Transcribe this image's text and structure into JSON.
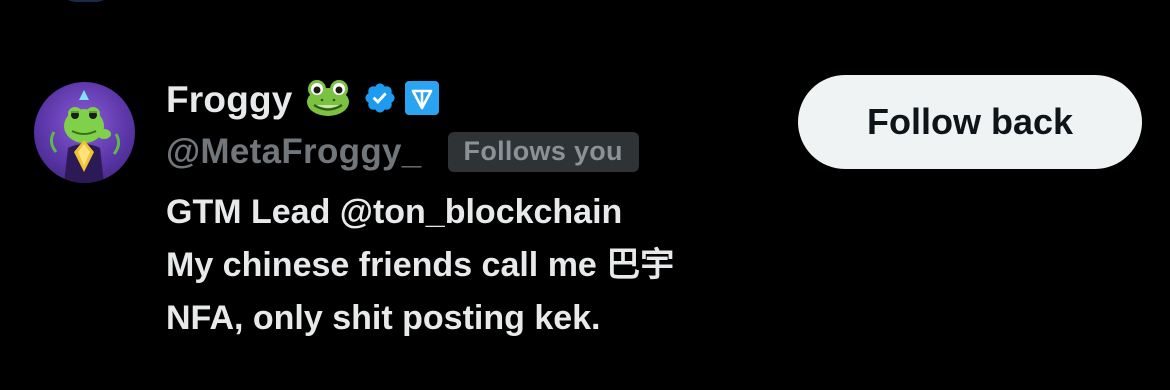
{
  "user": {
    "display_name": "Froggy",
    "name_emoji": "🐸",
    "handle": "@MetaFroggy_",
    "follows_you_label": "Follows you",
    "bio_lines": [
      "GTM Lead @ton_blockchain",
      "My chinese friends call me 巴宇",
      "NFA, only shit posting kek."
    ]
  },
  "actions": {
    "follow_back_label": "Follow back"
  },
  "icons": {
    "verified": "verified-badge-icon",
    "affiliate": "ton-logo-icon",
    "emoji": "frog-face-emoji"
  },
  "colors": {
    "background": "#000000",
    "primary_text": "#e7e9ea",
    "secondary_text": "#71767b",
    "verified_blue": "#1d9bf0",
    "ton_blue": "#2aa3f0",
    "button_bg": "#eff3f4",
    "button_text": "#0f1419",
    "pill_bg": "#2f3336"
  }
}
